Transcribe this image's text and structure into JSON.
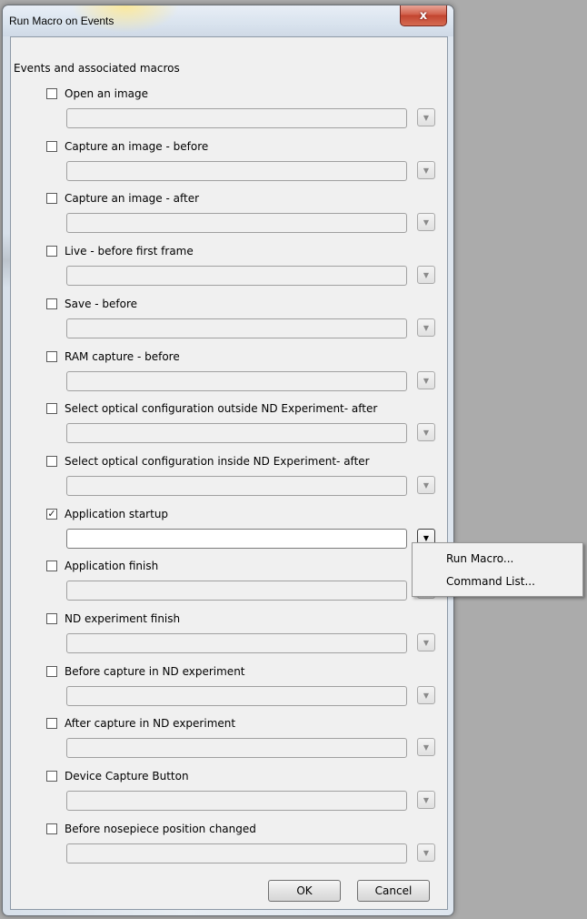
{
  "window": {
    "title": "Run Macro on Events",
    "close_glyph": "x"
  },
  "group_label": "Events and associated macros",
  "events": [
    {
      "label": "Open an image",
      "checked": false,
      "value": ""
    },
    {
      "label": "Capture an image - before",
      "checked": false,
      "value": ""
    },
    {
      "label": "Capture an image - after",
      "checked": false,
      "value": ""
    },
    {
      "label": "Live - before first frame",
      "checked": false,
      "value": ""
    },
    {
      "label": "Save - before",
      "checked": false,
      "value": ""
    },
    {
      "label": "RAM capture - before",
      "checked": false,
      "value": ""
    },
    {
      "label": "Select optical configuration outside ND Experiment- after",
      "checked": false,
      "value": ""
    },
    {
      "label": "Select optical configuration inside ND Experiment- after",
      "checked": false,
      "value": ""
    },
    {
      "label": "Application startup",
      "checked": true,
      "value": ""
    },
    {
      "label": "Application finish",
      "checked": false,
      "value": ""
    },
    {
      "label": "ND experiment finish",
      "checked": false,
      "value": ""
    },
    {
      "label": "Before capture in ND experiment",
      "checked": false,
      "value": ""
    },
    {
      "label": "After capture in ND experiment",
      "checked": false,
      "value": ""
    },
    {
      "label": "Device Capture Button",
      "checked": false,
      "value": ""
    },
    {
      "label": "Before nosepiece position changed",
      "checked": false,
      "value": ""
    }
  ],
  "buttons": {
    "ok": "OK",
    "cancel": "Cancel"
  },
  "popup_menu": {
    "items": [
      "Run Macro...",
      "Command List..."
    ]
  },
  "glyphs": {
    "check": "✓",
    "dropdown": "▼"
  }
}
